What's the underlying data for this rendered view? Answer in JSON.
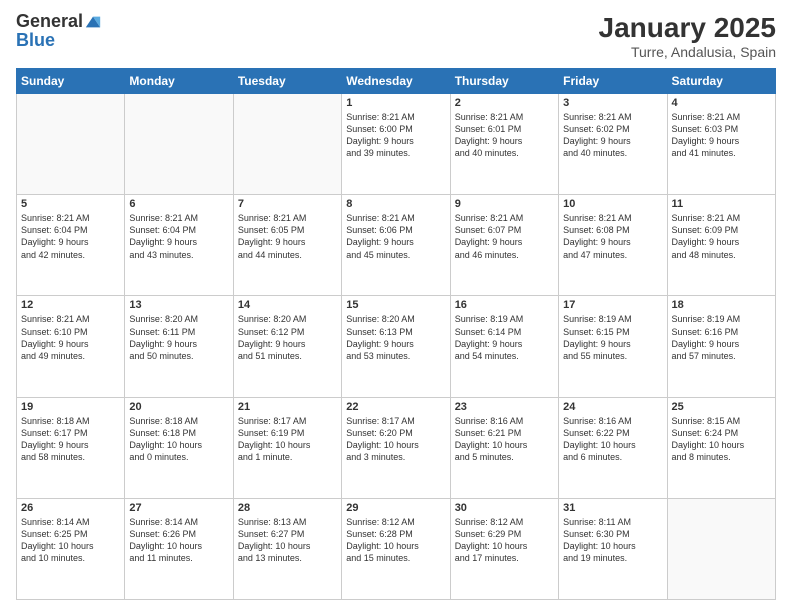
{
  "header": {
    "logo_line1": "General",
    "logo_line2": "Blue",
    "title": "January 2025",
    "subtitle": "Turre, Andalusia, Spain"
  },
  "weekdays": [
    "Sunday",
    "Monday",
    "Tuesday",
    "Wednesday",
    "Thursday",
    "Friday",
    "Saturday"
  ],
  "weeks": [
    [
      {
        "day": "",
        "info": ""
      },
      {
        "day": "",
        "info": ""
      },
      {
        "day": "",
        "info": ""
      },
      {
        "day": "1",
        "info": "Sunrise: 8:21 AM\nSunset: 6:00 PM\nDaylight: 9 hours\nand 39 minutes."
      },
      {
        "day": "2",
        "info": "Sunrise: 8:21 AM\nSunset: 6:01 PM\nDaylight: 9 hours\nand 40 minutes."
      },
      {
        "day": "3",
        "info": "Sunrise: 8:21 AM\nSunset: 6:02 PM\nDaylight: 9 hours\nand 40 minutes."
      },
      {
        "day": "4",
        "info": "Sunrise: 8:21 AM\nSunset: 6:03 PM\nDaylight: 9 hours\nand 41 minutes."
      }
    ],
    [
      {
        "day": "5",
        "info": "Sunrise: 8:21 AM\nSunset: 6:04 PM\nDaylight: 9 hours\nand 42 minutes."
      },
      {
        "day": "6",
        "info": "Sunrise: 8:21 AM\nSunset: 6:04 PM\nDaylight: 9 hours\nand 43 minutes."
      },
      {
        "day": "7",
        "info": "Sunrise: 8:21 AM\nSunset: 6:05 PM\nDaylight: 9 hours\nand 44 minutes."
      },
      {
        "day": "8",
        "info": "Sunrise: 8:21 AM\nSunset: 6:06 PM\nDaylight: 9 hours\nand 45 minutes."
      },
      {
        "day": "9",
        "info": "Sunrise: 8:21 AM\nSunset: 6:07 PM\nDaylight: 9 hours\nand 46 minutes."
      },
      {
        "day": "10",
        "info": "Sunrise: 8:21 AM\nSunset: 6:08 PM\nDaylight: 9 hours\nand 47 minutes."
      },
      {
        "day": "11",
        "info": "Sunrise: 8:21 AM\nSunset: 6:09 PM\nDaylight: 9 hours\nand 48 minutes."
      }
    ],
    [
      {
        "day": "12",
        "info": "Sunrise: 8:21 AM\nSunset: 6:10 PM\nDaylight: 9 hours\nand 49 minutes."
      },
      {
        "day": "13",
        "info": "Sunrise: 8:20 AM\nSunset: 6:11 PM\nDaylight: 9 hours\nand 50 minutes."
      },
      {
        "day": "14",
        "info": "Sunrise: 8:20 AM\nSunset: 6:12 PM\nDaylight: 9 hours\nand 51 minutes."
      },
      {
        "day": "15",
        "info": "Sunrise: 8:20 AM\nSunset: 6:13 PM\nDaylight: 9 hours\nand 53 minutes."
      },
      {
        "day": "16",
        "info": "Sunrise: 8:19 AM\nSunset: 6:14 PM\nDaylight: 9 hours\nand 54 minutes."
      },
      {
        "day": "17",
        "info": "Sunrise: 8:19 AM\nSunset: 6:15 PM\nDaylight: 9 hours\nand 55 minutes."
      },
      {
        "day": "18",
        "info": "Sunrise: 8:19 AM\nSunset: 6:16 PM\nDaylight: 9 hours\nand 57 minutes."
      }
    ],
    [
      {
        "day": "19",
        "info": "Sunrise: 8:18 AM\nSunset: 6:17 PM\nDaylight: 9 hours\nand 58 minutes."
      },
      {
        "day": "20",
        "info": "Sunrise: 8:18 AM\nSunset: 6:18 PM\nDaylight: 10 hours\nand 0 minutes."
      },
      {
        "day": "21",
        "info": "Sunrise: 8:17 AM\nSunset: 6:19 PM\nDaylight: 10 hours\nand 1 minute."
      },
      {
        "day": "22",
        "info": "Sunrise: 8:17 AM\nSunset: 6:20 PM\nDaylight: 10 hours\nand 3 minutes."
      },
      {
        "day": "23",
        "info": "Sunrise: 8:16 AM\nSunset: 6:21 PM\nDaylight: 10 hours\nand 5 minutes."
      },
      {
        "day": "24",
        "info": "Sunrise: 8:16 AM\nSunset: 6:22 PM\nDaylight: 10 hours\nand 6 minutes."
      },
      {
        "day": "25",
        "info": "Sunrise: 8:15 AM\nSunset: 6:24 PM\nDaylight: 10 hours\nand 8 minutes."
      }
    ],
    [
      {
        "day": "26",
        "info": "Sunrise: 8:14 AM\nSunset: 6:25 PM\nDaylight: 10 hours\nand 10 minutes."
      },
      {
        "day": "27",
        "info": "Sunrise: 8:14 AM\nSunset: 6:26 PM\nDaylight: 10 hours\nand 11 minutes."
      },
      {
        "day": "28",
        "info": "Sunrise: 8:13 AM\nSunset: 6:27 PM\nDaylight: 10 hours\nand 13 minutes."
      },
      {
        "day": "29",
        "info": "Sunrise: 8:12 AM\nSunset: 6:28 PM\nDaylight: 10 hours\nand 15 minutes."
      },
      {
        "day": "30",
        "info": "Sunrise: 8:12 AM\nSunset: 6:29 PM\nDaylight: 10 hours\nand 17 minutes."
      },
      {
        "day": "31",
        "info": "Sunrise: 8:11 AM\nSunset: 6:30 PM\nDaylight: 10 hours\nand 19 minutes."
      },
      {
        "day": "",
        "info": ""
      }
    ]
  ]
}
